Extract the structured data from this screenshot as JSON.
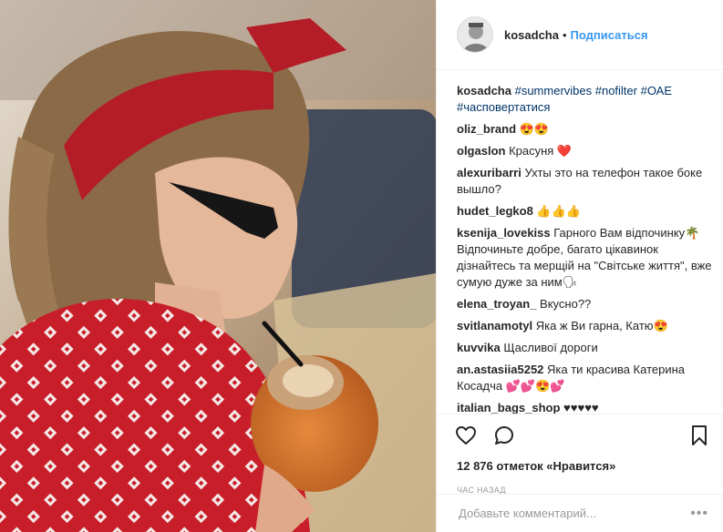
{
  "post": {
    "username": "kosadcha",
    "separator": "•",
    "follow_label": "Подписаться",
    "caption": {
      "username": "kosadcha",
      "text": " #summervibes #nofilter #ОАЕ #часповертатися"
    },
    "photo_alt": "Post photo"
  },
  "comments": [
    {
      "user": "oliz_brand",
      "text": " 😍😍"
    },
    {
      "user": "olgaslon",
      "text": " Красуня ❤️"
    },
    {
      "user": "alexuribarri",
      "text": " Ухты это на телефон такое боке вышло?"
    },
    {
      "user": "hudet_legko8",
      "text": " 👍👍👍"
    },
    {
      "user": "ksenija_lovekiss",
      "text": " Гарного Вам відпочинку🌴 Відпочиньте добре, багато цікавинок дізнайтесь та мерщій на \"Світське життя\", вже сумую дуже за ним🗣"
    },
    {
      "user": "elena_troyan_",
      "text": " Вкусно??"
    },
    {
      "user": "svitlanamotyl",
      "text": " Яка ж Ви гарна, Катю😍"
    },
    {
      "user": "kuvvika",
      "text": " Щасливої дороги"
    },
    {
      "user": "an.astasiia5252",
      "text": " Яка ти красива Катерина Косадча 💕💕😍💕"
    },
    {
      "user": "italian_bags_shop",
      "text": " ♥♥♥♥♥"
    }
  ],
  "actions": {
    "like_icon": "heart-icon",
    "comment_icon": "comment-icon",
    "save_icon": "bookmark-icon"
  },
  "likes_text": "12 876 отметок «Нравится»",
  "time_text": "час назад",
  "add_comment": {
    "placeholder": "Добавьте комментарий...",
    "more_label": "•••"
  },
  "colors": {
    "link": "#3897f0",
    "hashtag": "#003569",
    "muted": "#999999"
  }
}
